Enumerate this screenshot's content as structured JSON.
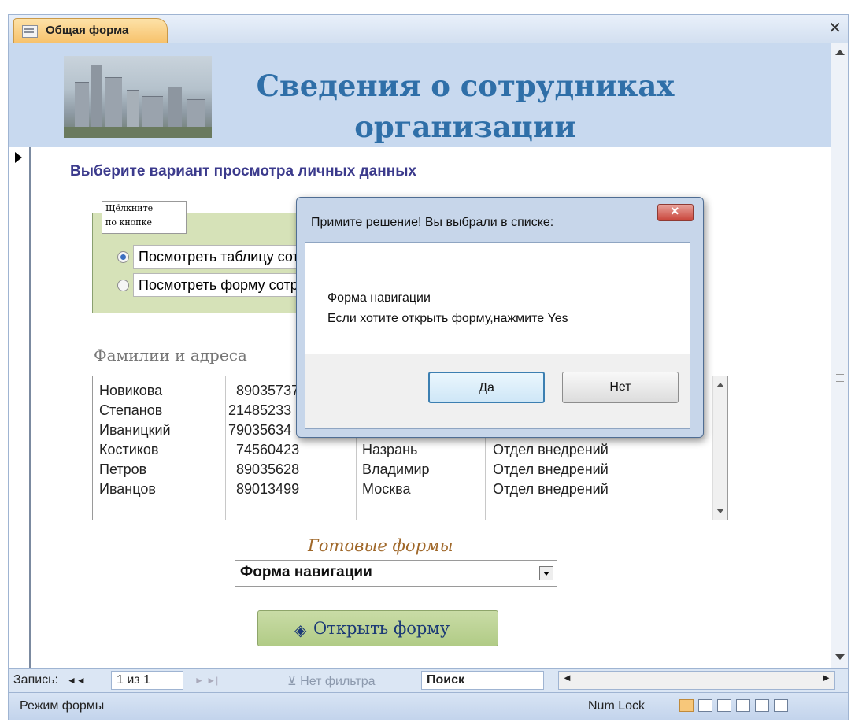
{
  "window": {
    "tab_label": "Общая форма",
    "close_glyph": "✕"
  },
  "header": {
    "title_line1": "Сведения о сотрудниках",
    "title_line2": "организации",
    "image_icon": "city-photo"
  },
  "form": {
    "subtitle": "Выберите вариант просмотра личных данных",
    "option_group_label_line1": "Щёлкните",
    "option_group_label_line2": "по кнопке",
    "options": [
      {
        "label": "Посмотреть таблицу сотрудников",
        "selected": true
      },
      {
        "label": "Посмотреть форму сотрудников",
        "selected": false
      }
    ],
    "list_caption": "Фамилии и адреса",
    "list_rows": [
      {
        "name": "Новикова",
        "phone": "89035737",
        "city": "",
        "dept": ""
      },
      {
        "name": "Степанов",
        "phone": "21485233",
        "city": "",
        "dept": ""
      },
      {
        "name": "Иваницкий",
        "phone": "79035634",
        "city": "",
        "dept": ""
      },
      {
        "name": "Костиков",
        "phone": "74560423",
        "city": "Назрань",
        "dept": "Отдел внедрений"
      },
      {
        "name": "Петров",
        "phone": "89035628",
        "city": "Владимир",
        "dept": "Отдел внедрений"
      },
      {
        "name": "Иванцов",
        "phone": "89013499",
        "city": "Москва",
        "dept": "Отдел внедрений"
      }
    ],
    "ready_forms_label": "Готовые формы",
    "combo_value": "Форма навигации",
    "open_button_label": "Открыть форму",
    "open_button_icon": "binoculars-icon"
  },
  "record_nav": {
    "label": "Запись:",
    "first_glyph": "◄◄",
    "current": "1 из 1",
    "filter_label": "Нет фильтра",
    "search_label": "Поиск"
  },
  "status": {
    "mode": "Режим формы",
    "numlock": "Num Lock"
  },
  "dialog": {
    "title": "Примите решение! Вы выбрали в списке:",
    "message_line1": "Форма навигации",
    "message_line2": "Если хотите открыть форму,нажмите Yes",
    "yes_label": "Да",
    "no_label": "Нет"
  },
  "colors": {
    "title_blue": "#2f6fa8",
    "header_bg": "#c8d9ef",
    "option_group_bg": "#d6e2b8",
    "open_button_bg": "#b1cb86",
    "tab_orange": "#f7c16a"
  }
}
